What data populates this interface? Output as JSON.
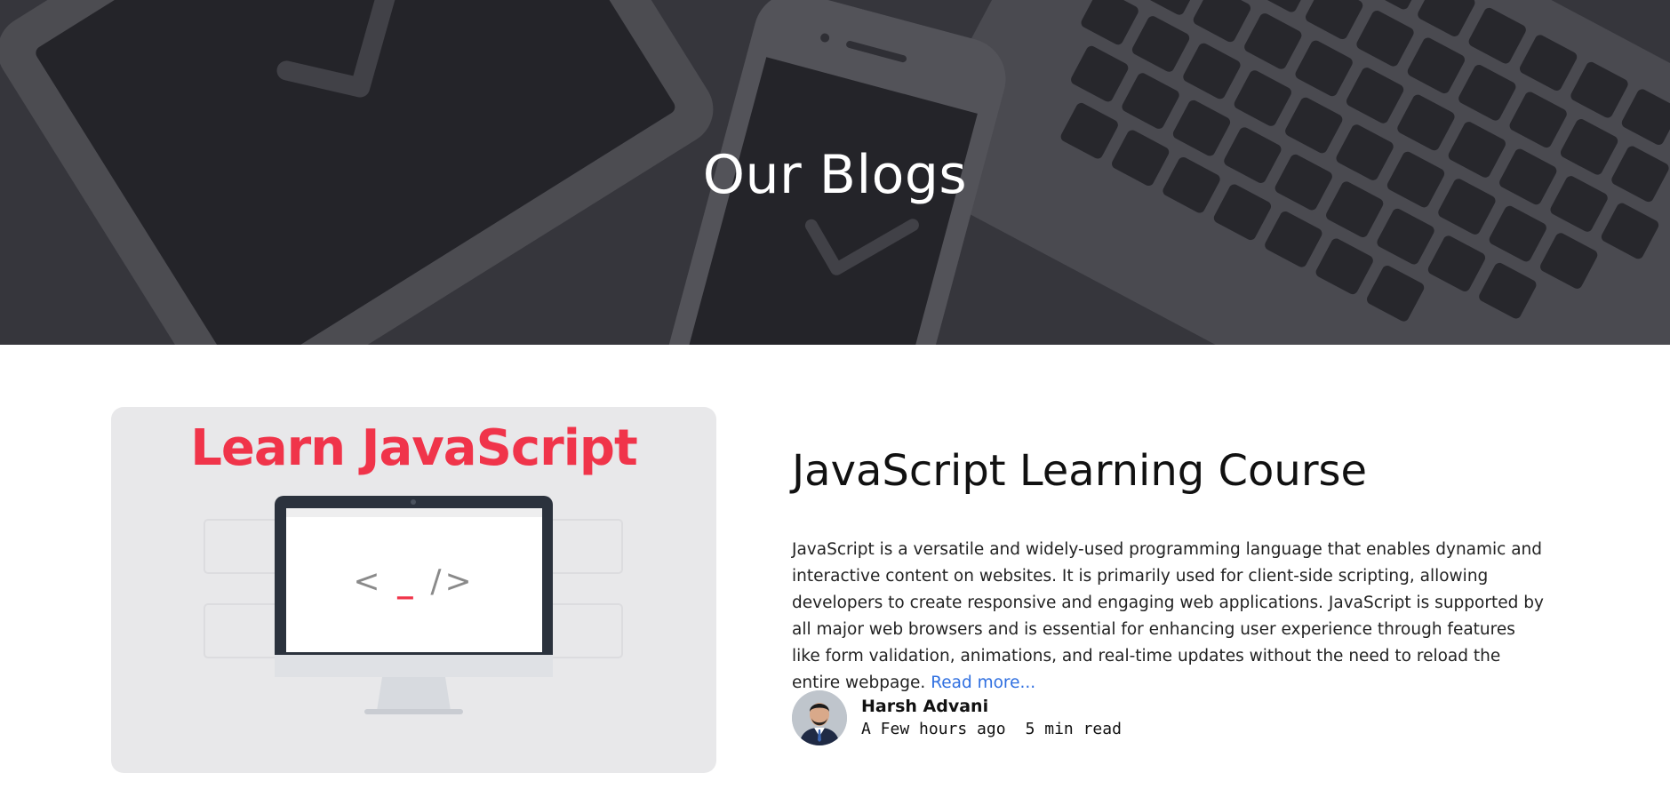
{
  "hero": {
    "title": "Our Blogs"
  },
  "blog": {
    "image": {
      "heading": "Learn JavaScript",
      "code_glyph": "< _ />"
    },
    "title": "JavaScript Learning Course",
    "excerpt": "JavaScript is a versatile and widely-used programming language that enables dynamic and interactive content on websites. It is primarily used for client-side scripting, allowing developers to create responsive and engaging web applications. JavaScript is supported by all major web browsers and is essential for enhancing user experience through features like form validation, animations, and real-time updates without the need to reload the entire webpage.",
    "read_more": "Read more...",
    "author": {
      "name": "Harsh Advani",
      "posted": "A Few hours ago",
      "read_time": "5 min read"
    }
  },
  "colors": {
    "accent_red": "#f0344a",
    "link_blue": "#2f6fe0",
    "hero_overlay": "#3b3b42"
  }
}
